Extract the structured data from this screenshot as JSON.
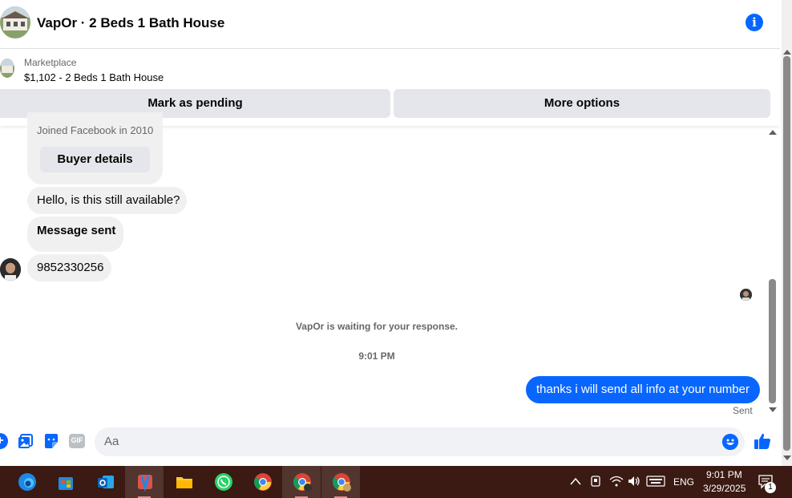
{
  "header": {
    "title": "VapOr · 2 Beds 1 Bath House"
  },
  "marketplace": {
    "label": "Marketplace",
    "listing": "$1,102 - 2 Beds 1 Bath House",
    "mark_pending": "Mark as pending",
    "more_options": "More options"
  },
  "conversation": {
    "joined": "Joined Facebook in 2010",
    "buyer_details": "Buyer details",
    "incoming": [
      "Hello, is this still available?",
      "Message sent",
      "9852330256"
    ],
    "waiting_notice": "VapOr is waiting for your response.",
    "timestamp": "9:01 PM",
    "outgoing": "thanks i will send all info at your number",
    "status": "Sent"
  },
  "composer": {
    "placeholder": "Aa",
    "gif_label": "GIF"
  },
  "taskbar": {
    "language": "ENG",
    "time": "9:01 PM",
    "date": "3/29/2025",
    "notification_count": "1"
  },
  "colors": {
    "accent": "#0866ff",
    "bubble_in": "#f0f0f0",
    "button_bg": "#e4e6eb",
    "taskbar_bg": "#3a1a12"
  }
}
